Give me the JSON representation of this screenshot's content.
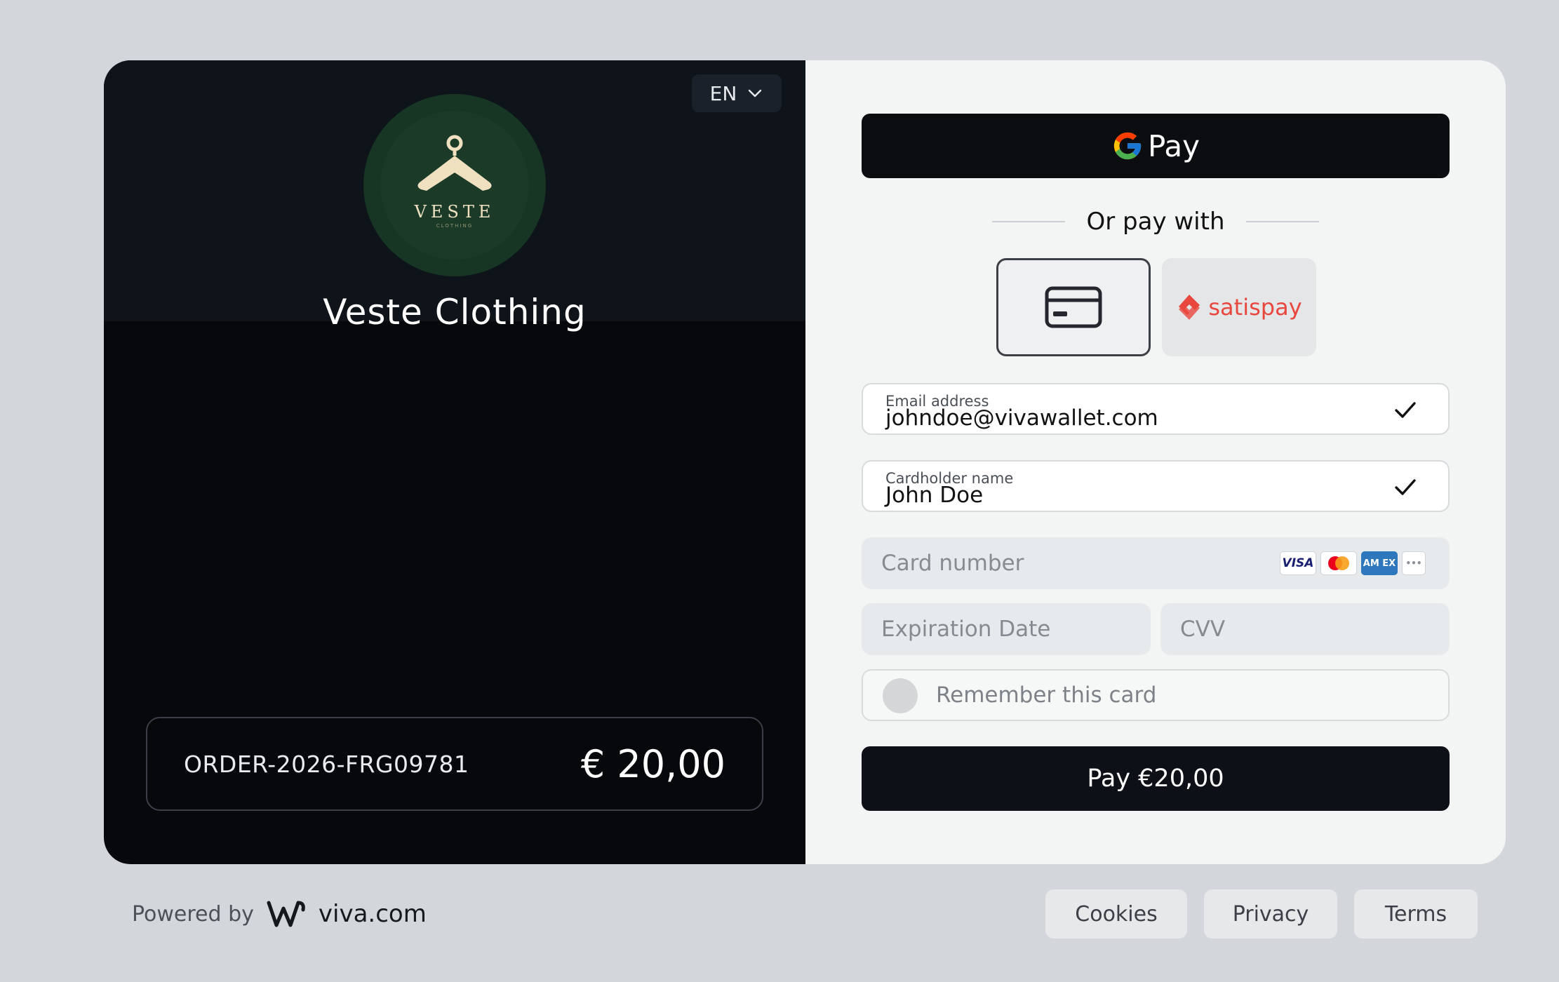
{
  "language": {
    "selected": "EN"
  },
  "merchant": {
    "name": "Veste Clothing",
    "logo_word": "VESTE",
    "logo_sub": "CLOTHING"
  },
  "order": {
    "id": "ORDER-2026-FRG09781",
    "amount": "€ 20,00"
  },
  "wallet": {
    "gpay_label": "Pay"
  },
  "divider": {
    "text": "Or pay with"
  },
  "methods": {
    "satispay_label": "satispay"
  },
  "form": {
    "email": {
      "label": "Email address",
      "value": "johndoe@vivawallet.com"
    },
    "cardholder": {
      "label": "Cardholder name",
      "value": "John Doe"
    },
    "card_number": {
      "placeholder": "Card number"
    },
    "expiry": {
      "placeholder": "Expiration Date"
    },
    "cvv": {
      "placeholder": "CVV"
    },
    "remember": {
      "label": "Remember this card"
    }
  },
  "brands": {
    "visa": "VISA",
    "amex": "AM EX",
    "more": "•••"
  },
  "pay_button": {
    "label": "Pay €20,00"
  },
  "footer": {
    "powered_by": "Powered by",
    "provider": "viva.com",
    "links": [
      "Cookies",
      "Privacy",
      "Terms"
    ]
  },
  "colors": {
    "dark_panel": "#06080c",
    "logo_green": "#173623",
    "satispay_red": "#e8473e"
  }
}
